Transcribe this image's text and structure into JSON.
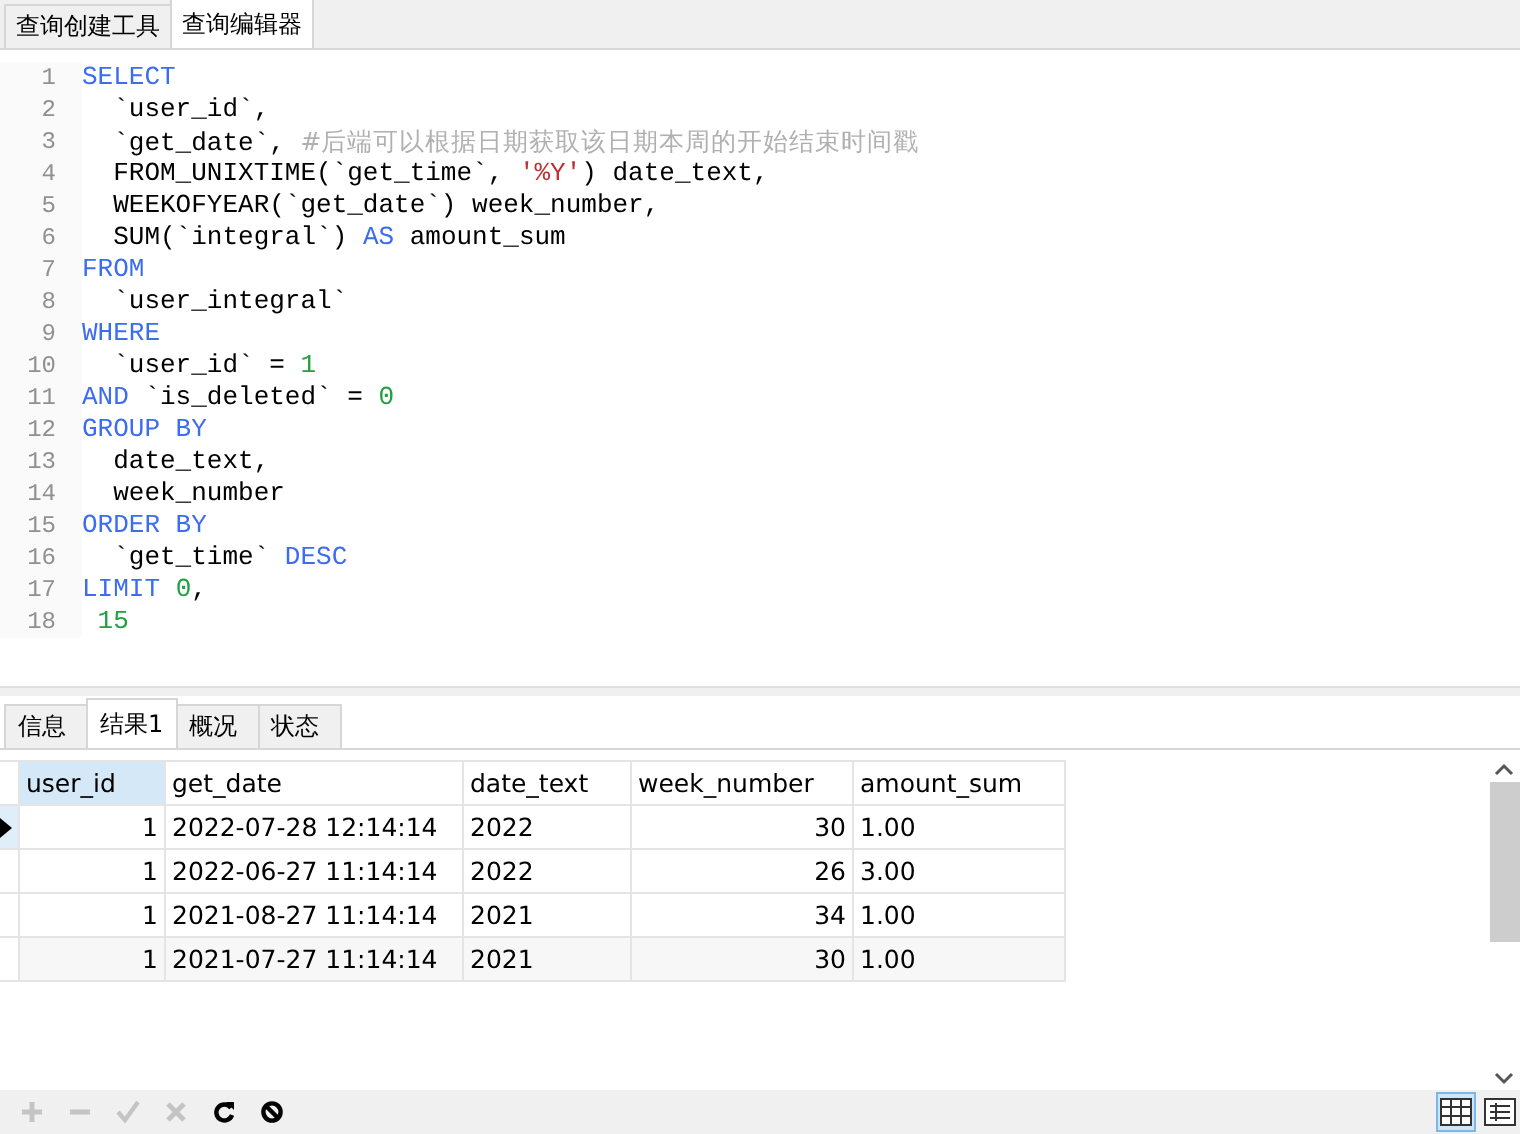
{
  "editor_tabs": [
    {
      "label": "查询创建工具",
      "selected": false
    },
    {
      "label": "查询编辑器",
      "selected": true
    }
  ],
  "code_lines": [
    {
      "number": "1",
      "tokens": [
        {
          "kind": "kw",
          "text": "SELECT"
        }
      ]
    },
    {
      "number": "2",
      "tokens": [
        {
          "kind": "id",
          "text": "  `user_id`,"
        }
      ]
    },
    {
      "number": "3",
      "tokens": [
        {
          "kind": "id",
          "text": "  `get_date`, "
        },
        {
          "kind": "comment",
          "text": "#后端可以根据日期获取该日期本周的开始结束时间戳"
        }
      ]
    },
    {
      "number": "4",
      "tokens": [
        {
          "kind": "id",
          "text": "  FROM_UNIXTIME(`get_time`, "
        },
        {
          "kind": "str",
          "text": "'%Y'"
        },
        {
          "kind": "id",
          "text": ") date_text,"
        }
      ]
    },
    {
      "number": "5",
      "tokens": [
        {
          "kind": "id",
          "text": "  WEEKOFYEAR(`get_date`) week_number,"
        }
      ]
    },
    {
      "number": "6",
      "tokens": [
        {
          "kind": "id",
          "text": "  SUM(`integral`) "
        },
        {
          "kind": "kw",
          "text": "AS"
        },
        {
          "kind": "id",
          "text": " amount_sum"
        }
      ]
    },
    {
      "number": "7",
      "tokens": [
        {
          "kind": "kw",
          "text": "FROM"
        }
      ]
    },
    {
      "number": "8",
      "tokens": [
        {
          "kind": "id",
          "text": "  `user_integral`"
        }
      ]
    },
    {
      "number": "9",
      "tokens": [
        {
          "kind": "kw",
          "text": "WHERE"
        }
      ]
    },
    {
      "number": "10",
      "tokens": [
        {
          "kind": "id",
          "text": "  `user_id` = "
        },
        {
          "kind": "num",
          "text": "1"
        }
      ]
    },
    {
      "number": "11",
      "tokens": [
        {
          "kind": "kw",
          "text": "AND"
        },
        {
          "kind": "id",
          "text": " `is_deleted` = "
        },
        {
          "kind": "num",
          "text": "0"
        }
      ]
    },
    {
      "number": "12",
      "tokens": [
        {
          "kind": "kw",
          "text": "GROUP BY"
        }
      ]
    },
    {
      "number": "13",
      "tokens": [
        {
          "kind": "id",
          "text": "  date_text,"
        }
      ]
    },
    {
      "number": "14",
      "tokens": [
        {
          "kind": "id",
          "text": "  week_number"
        }
      ]
    },
    {
      "number": "15",
      "tokens": [
        {
          "kind": "kw",
          "text": "ORDER BY"
        }
      ]
    },
    {
      "number": "16",
      "tokens": [
        {
          "kind": "id",
          "text": "  `get_time` "
        },
        {
          "kind": "kw",
          "text": "DESC"
        }
      ]
    },
    {
      "number": "17",
      "tokens": [
        {
          "kind": "kw",
          "text": "LIMIT "
        },
        {
          "kind": "num",
          "text": "0"
        },
        {
          "kind": "id",
          "text": ","
        }
      ]
    },
    {
      "number": "18",
      "tokens": [
        {
          "kind": "num",
          "text": " 15"
        }
      ]
    }
  ],
  "result_tabs": [
    {
      "label": "信息",
      "selected": false
    },
    {
      "label": "结果1",
      "selected": true
    },
    {
      "label": "概况",
      "selected": false
    },
    {
      "label": "状态",
      "selected": false
    }
  ],
  "table": {
    "columns": [
      {
        "label": "user_id",
        "kind": "integer",
        "selected": true
      },
      {
        "label": "get_date",
        "kind": "text",
        "selected": false
      },
      {
        "label": "date_text",
        "kind": "text",
        "selected": false
      },
      {
        "label": "week_number",
        "kind": "integer",
        "selected": false
      },
      {
        "label": "amount_sum",
        "kind": "text",
        "selected": false
      }
    ],
    "rows": [
      {
        "current": true,
        "cells": [
          "1",
          "2022-07-28 12:14:14",
          "2022",
          "30",
          "1.00"
        ]
      },
      {
        "current": false,
        "cells": [
          "1",
          "2022-06-27 11:14:14",
          "2022",
          "26",
          "3.00"
        ]
      },
      {
        "current": false,
        "cells": [
          "1",
          "2021-08-27 11:14:14",
          "2021",
          "34",
          "1.00"
        ]
      },
      {
        "current": false,
        "cells": [
          "1",
          "2021-07-27 11:14:14",
          "2021",
          "30",
          "1.00"
        ]
      }
    ]
  },
  "toolbar": [
    {
      "kind": "add",
      "disabled": true
    },
    {
      "kind": "remove",
      "disabled": true
    },
    {
      "kind": "apply",
      "disabled": true
    },
    {
      "kind": "discard",
      "disabled": true
    },
    {
      "kind": "refresh",
      "disabled": false
    },
    {
      "kind": "stop",
      "disabled": false
    }
  ],
  "views": [
    {
      "kind": "grid",
      "selected": true
    },
    {
      "kind": "form",
      "selected": false
    }
  ]
}
